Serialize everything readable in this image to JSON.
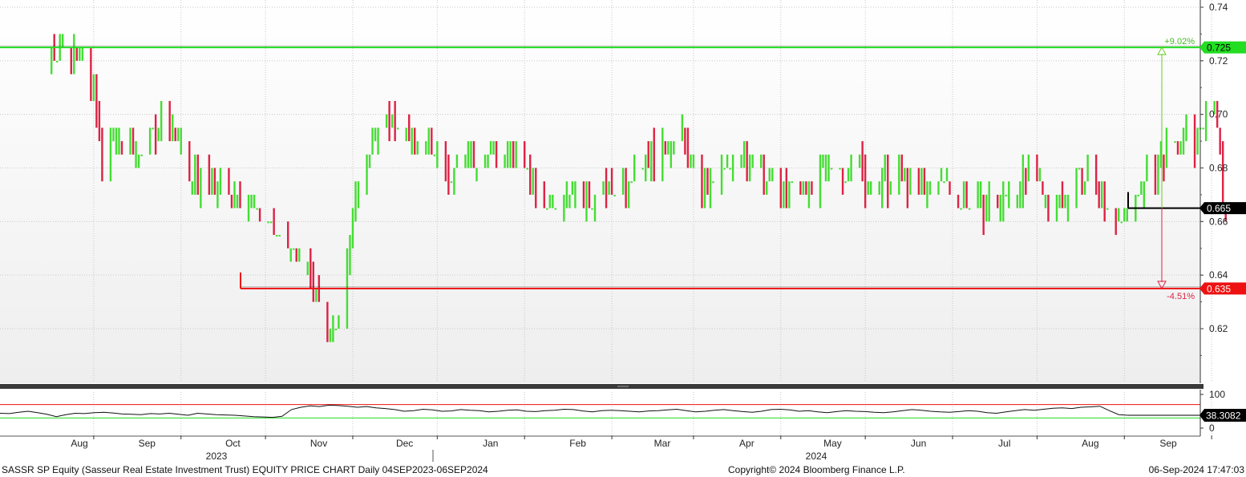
{
  "footer": {
    "description": "SASSR SP Equity (Sasseur Real Estate Investment Trust) EQUITY PRICE CHART  Daily 04SEP2023-06SEP2024",
    "copyright": "Copyright© 2024 Bloomberg Finance L.P.",
    "timestamp": "06-Sep-2024 17:47:03"
  },
  "colors": {
    "up": "#44dd33",
    "down": "#dd2244",
    "resistance": "#22dd22",
    "support": "#ee1111",
    "last": "#000000",
    "grid": "#c8c8c8",
    "rsi_line": "#111111"
  },
  "chart_data": [
    {
      "type": "line",
      "subtype": "price-bars",
      "title": "",
      "x_tick_labels": [
        "Aug",
        "Sep",
        "Oct",
        "Nov",
        "Dec",
        "Jan",
        "Feb",
        "Mar",
        "Apr",
        "May",
        "Jun",
        "Jul",
        "Aug",
        "Sep"
      ],
      "year_labels": [
        "2023",
        "2024"
      ],
      "y_tick_labels": [
        "0.74",
        "0.72",
        "0.70",
        "0.68",
        "0.66",
        "0.64",
        "0.62"
      ],
      "ylim": [
        0.6,
        0.742
      ],
      "grid": true,
      "anchors": [
        [
          "2023-07-15",
          0.722
        ],
        [
          "2023-07-20",
          0.726
        ],
        [
          "2023-07-25",
          0.724
        ],
        [
          "2023-07-29",
          0.72
        ],
        [
          "2023-08-01",
          0.705
        ],
        [
          "2023-08-04",
          0.685
        ],
        [
          "2023-08-10",
          0.688
        ],
        [
          "2023-08-17",
          0.686
        ],
        [
          "2023-08-25",
          0.696
        ],
        [
          "2023-08-31",
          0.692
        ],
        [
          "2023-09-04",
          0.676
        ],
        [
          "2023-09-11",
          0.674
        ],
        [
          "2023-09-18",
          0.672
        ],
        [
          "2023-09-25",
          0.666
        ],
        [
          "2023-10-02",
          0.66
        ],
        [
          "2023-10-06",
          0.652
        ],
        [
          "2023-10-10",
          0.648
        ],
        [
          "2023-10-14",
          0.646
        ],
        [
          "2023-10-18",
          0.636
        ],
        [
          "2023-10-22",
          0.625
        ],
        [
          "2023-10-24",
          0.617
        ],
        [
          "2023-10-27",
          0.624
        ],
        [
          "2023-10-30",
          0.645
        ],
        [
          "2023-11-02",
          0.665
        ],
        [
          "2023-11-06",
          0.688
        ],
        [
          "2023-11-09",
          0.69
        ],
        [
          "2023-11-13",
          0.697
        ],
        [
          "2023-11-17",
          0.7
        ],
        [
          "2023-11-21",
          0.69
        ],
        [
          "2023-11-25",
          0.686
        ],
        [
          "2023-11-29",
          0.688
        ],
        [
          "2023-12-04",
          0.675
        ],
        [
          "2023-12-11",
          0.684
        ],
        [
          "2023-12-18",
          0.685
        ],
        [
          "2023-12-25",
          0.686
        ],
        [
          "2024-01-01",
          0.685
        ],
        [
          "2024-01-08",
          0.665
        ],
        [
          "2024-01-15",
          0.668
        ],
        [
          "2024-01-22",
          0.666
        ],
        [
          "2024-01-29",
          0.67
        ],
        [
          "2024-02-05",
          0.674
        ],
        [
          "2024-02-12",
          0.684
        ],
        [
          "2024-02-19",
          0.686
        ],
        [
          "2024-02-26",
          0.69
        ],
        [
          "2024-03-04",
          0.672
        ],
        [
          "2024-03-11",
          0.676
        ],
        [
          "2024-03-18",
          0.685
        ],
        [
          "2024-03-25",
          0.68
        ],
        [
          "2024-04-01",
          0.671
        ],
        [
          "2024-04-08",
          0.672
        ],
        [
          "2024-04-15",
          0.675
        ],
        [
          "2024-04-22",
          0.679
        ],
        [
          "2024-04-29",
          0.684
        ],
        [
          "2024-05-01",
          0.671
        ],
        [
          "2024-05-08",
          0.674
        ],
        [
          "2024-05-15",
          0.676
        ],
        [
          "2024-05-22",
          0.671
        ],
        [
          "2024-05-29",
          0.675
        ],
        [
          "2024-06-05",
          0.667
        ],
        [
          "2024-06-12",
          0.665
        ],
        [
          "2024-06-19",
          0.668
        ],
        [
          "2024-06-26",
          0.677
        ],
        [
          "2024-07-03",
          0.671
        ],
        [
          "2024-07-10",
          0.667
        ],
        [
          "2024-07-17",
          0.681
        ],
        [
          "2024-07-24",
          0.668
        ],
        [
          "2024-07-31",
          0.661
        ],
        [
          "2024-08-05",
          0.671
        ],
        [
          "2024-08-12",
          0.68
        ],
        [
          "2024-08-19",
          0.688
        ],
        [
          "2024-08-26",
          0.69
        ],
        [
          "2024-08-30",
          0.7
        ],
        [
          "2024-09-02",
          0.702
        ],
        [
          "2024-09-03",
          0.697
        ],
        [
          "2024-09-05",
          0.668
        ],
        [
          "2024-09-06",
          0.665
        ]
      ],
      "resistance": {
        "value": 0.725,
        "label": "0.725",
        "change_label": "+9.02%"
      },
      "support": {
        "value": 0.635,
        "label": "0.635",
        "change_label": "-4.51%"
      },
      "last": {
        "value": 0.665,
        "label": "0.665"
      },
      "date_range": [
        "2023-07-15",
        "2024-09-06"
      ]
    },
    {
      "type": "line",
      "subtype": "rsi",
      "title": "",
      "y_tick_labels": [
        "100",
        "0"
      ],
      "ylim": [
        0,
        100
      ],
      "upper_band": 70,
      "lower_band": 30,
      "last_label": "38.3082",
      "series": [
        {
          "values": [
            44,
            43,
            47,
            50,
            46,
            41,
            34,
            40,
            44,
            43,
            46,
            47,
            45,
            42,
            41,
            40,
            43,
            42,
            44,
            41,
            38,
            44,
            42,
            40,
            39,
            38,
            36,
            34,
            33,
            32,
            35,
            55,
            62,
            66,
            64,
            68,
            67,
            65,
            62,
            64,
            60,
            58,
            55,
            50,
            52,
            56,
            54,
            50,
            51,
            55,
            53,
            52,
            48,
            50,
            53,
            54,
            50,
            49,
            52,
            53,
            56,
            55,
            51,
            48,
            52,
            53,
            52,
            50,
            48,
            51,
            52,
            54,
            56,
            52,
            48,
            50,
            53,
            55,
            52,
            49,
            47,
            50,
            55,
            56,
            54,
            50,
            52,
            48,
            46,
            49,
            52,
            50,
            49,
            47,
            46,
            48,
            52,
            55,
            53,
            50,
            48,
            47,
            49,
            52,
            50,
            46,
            44,
            48,
            52,
            55,
            53,
            56,
            59,
            60,
            58,
            62,
            63,
            65,
            52,
            40,
            38
          ]
        }
      ]
    }
  ]
}
